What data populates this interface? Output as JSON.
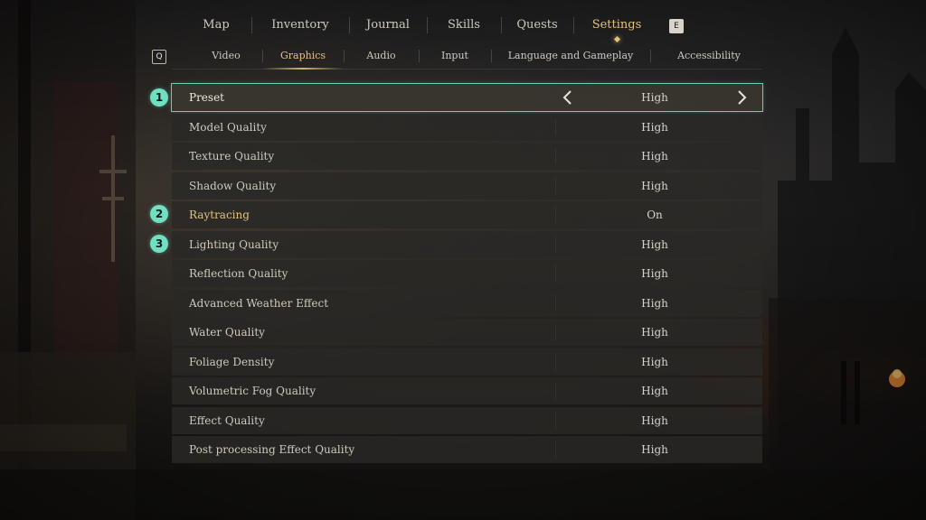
{
  "top_tabs": [
    {
      "label": "Map"
    },
    {
      "label": "Inventory"
    },
    {
      "label": "Journal"
    },
    {
      "label": "Skills"
    },
    {
      "label": "Quests"
    },
    {
      "label": "Settings"
    }
  ],
  "key_hints": {
    "next": "E",
    "prev": "Q"
  },
  "sub_tabs": [
    {
      "label": "Video"
    },
    {
      "label": "Graphics"
    },
    {
      "label": "Audio"
    },
    {
      "label": "Input"
    },
    {
      "label": "Language and Gameplay"
    },
    {
      "label": "Accessibility"
    }
  ],
  "markers": [
    "1",
    "2",
    "3"
  ],
  "settings": [
    {
      "label": "Preset",
      "value": "High"
    },
    {
      "label": "Model Quality",
      "value": "High"
    },
    {
      "label": "Texture Quality",
      "value": "High"
    },
    {
      "label": "Shadow Quality",
      "value": "High"
    },
    {
      "label": "Raytracing",
      "value": "On"
    },
    {
      "label": "Lighting Quality",
      "value": "High"
    },
    {
      "label": "Reflection Quality",
      "value": "High"
    },
    {
      "label": "Advanced Weather Effect",
      "value": "High"
    },
    {
      "label": "Water Quality",
      "value": "High"
    },
    {
      "label": "Foliage Density",
      "value": "High"
    },
    {
      "label": "Volumetric Fog Quality",
      "value": "High"
    },
    {
      "label": "Effect Quality",
      "value": "High"
    },
    {
      "label": "Post processing Effect Quality",
      "value": "High"
    }
  ],
  "colors": {
    "accent_gold": "#e3c27e",
    "marker_teal": "#6fe0c2",
    "selection_outline": "#5fd4b2"
  }
}
